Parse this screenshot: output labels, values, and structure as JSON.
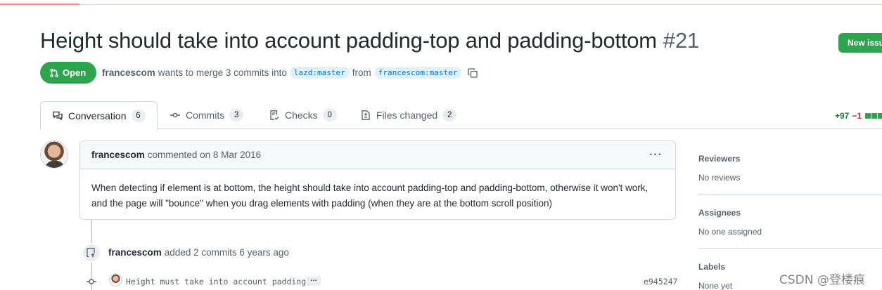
{
  "pr": {
    "title": "Height should take into account padding-top and padding-bottom",
    "number": "#21",
    "state": "Open",
    "author": "francescom",
    "meta_text": "wants to merge 3 commits into",
    "base_branch": "lazd:master",
    "from_text": "from",
    "head_branch": "francescom:master"
  },
  "header": {
    "new_issue_label": "New issue"
  },
  "tabs": [
    {
      "label": "Conversation",
      "count": "6",
      "icon": "comment-discussion-icon"
    },
    {
      "label": "Commits",
      "count": "3",
      "icon": "git-commit-icon"
    },
    {
      "label": "Checks",
      "count": "0",
      "icon": "checklist-icon"
    },
    {
      "label": "Files changed",
      "count": "2",
      "icon": "file-diff-icon"
    }
  ],
  "diffstat": {
    "additions": "+97",
    "deletions": "−1"
  },
  "comment": {
    "author": "francescom",
    "action": "commented on 8 Mar 2016",
    "menu": "···",
    "body": "When detecting if element is at bottom, the height should take into account padding-top and padding-bottom, otherwise it won't work, and the page will \"bounce\" when you drag elements with padding (when they are at the bottom scroll position)"
  },
  "timeline_event": {
    "author": "francescom",
    "text": "added 2 commits 6 years ago"
  },
  "commit": {
    "message": "Height must take into account padding",
    "ellipsis": "…",
    "sha": "e945247"
  },
  "sidebar": {
    "reviewers": {
      "label": "Reviewers",
      "value": "No reviews"
    },
    "assignees": {
      "label": "Assignees",
      "value": "No one assigned"
    },
    "labels": {
      "label": "Labels",
      "value": "None yet"
    }
  },
  "watermark": "CSDN @登楼痕",
  "colors": {
    "open_green": "#2da44e",
    "branch_bg": "#ddf4ff",
    "branch_text": "#0969da",
    "border": "#d0d7de",
    "muted": "#57606a",
    "tab_accent": "#fd8c73"
  }
}
